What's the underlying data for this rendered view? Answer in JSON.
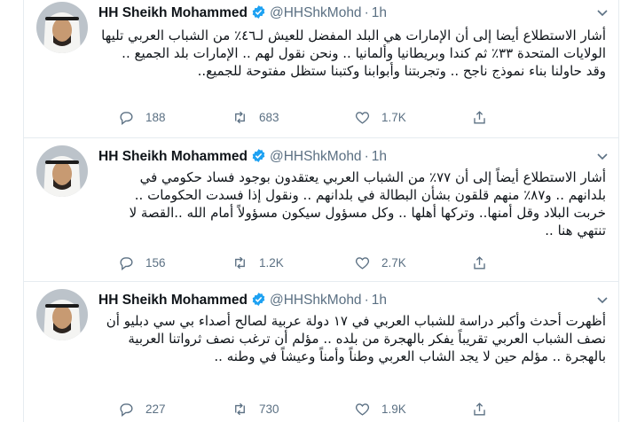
{
  "tweets": [
    {
      "author": "HH Sheikh Mohammed",
      "handle": "@HHShkMohd",
      "separator": "·",
      "time": "1h",
      "text": "أشار الاستطلاع أيضا إلى أن الإمارات هي البلد المفضل للعيش لـ٤٦٪ من الشباب العربي تليها الولايات المتحدة ٣٣٪ ثم كندا وبريطانيا وألمانيا .. ونحن نقول لهم .. الإمارات بلد الجميع .. وقد حاولنا بناء نموذج ناجح .. وتجربتنا وأبوابنا وكتبنا ستظل مفتوحة للجميع..",
      "replies": "188",
      "retweets": "683",
      "likes": "1.7K"
    },
    {
      "author": "HH Sheikh Mohammed",
      "handle": "@HHShkMohd",
      "separator": "·",
      "time": "1h",
      "text": "أشار الاستطلاع أيضاً إلى أن ٧٧٪ من الشباب العربي يعتقدون بوجود فساد حكومي في بلدانهم .. و٨٧٪ منهم قلقون بشأن البطالة في بلدانهم .. ونقول إذا فسدت الحكومات .. خربت البلاد وقل أمنها.. وتركها أهلها .. وكل مسؤول سيكون مسؤولاً أمام الله ..القصة لا تنتهي هنا ..",
      "replies": "156",
      "retweets": "1.2K",
      "likes": "2.7K"
    },
    {
      "author": "HH Sheikh Mohammed",
      "handle": "@HHShkMohd",
      "separator": "·",
      "time": "1h",
      "text": "أظهرت أحدث وأكبر دراسة للشباب العربي في ١٧ دولة عربية لصالح أصداء بي سي دبليو أن نصف الشباب العربي تقريباً يفكر بالهجرة من بلده .. مؤلم أن ترغب نصف ثرواتنا العربية بالهجرة .. مؤلم حين لا يجد الشاب العربي وطناً وأمناً وعيشاً في وطنه ..",
      "replies": "227",
      "retweets": "730",
      "likes": "1.9K"
    }
  ],
  "icons": {
    "verified": "verified-badge-icon",
    "caret": "chevron-down-icon",
    "reply": "reply-icon",
    "retweet": "retweet-icon",
    "like": "heart-icon",
    "share": "share-icon"
  },
  "colors": {
    "text": "#0f1419",
    "secondary": "#5b7083",
    "verified": "#1da1f2",
    "divider": "#e6ecf0"
  }
}
